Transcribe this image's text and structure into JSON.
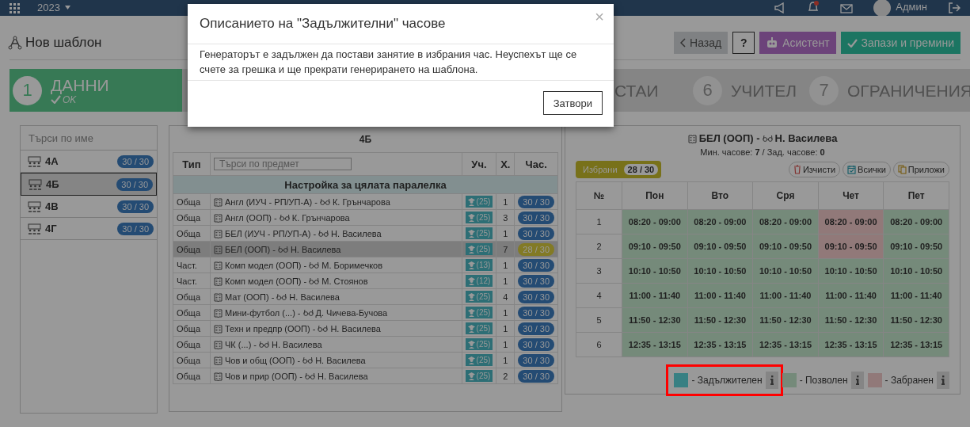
{
  "header": {
    "year": "2023",
    "user": "Админ"
  },
  "page": {
    "title": "Нов шаблон",
    "buttons": [
      {
        "label": "Назад",
        "kind": "back"
      },
      {
        "label": "?",
        "kind": "help"
      },
      {
        "label": "Асистент",
        "kind": "assistant"
      },
      {
        "label": "Запази и премини",
        "kind": "save"
      }
    ]
  },
  "steps": [
    {
      "number": "1",
      "label": "ДАННИ",
      "status": "OK",
      "done": true
    },
    {
      "label": "СТАИ",
      "done": false
    },
    {
      "number": "6",
      "label": "УЧИТЕЛ",
      "done": false
    },
    {
      "number": "7",
      "label": "ОГРАНИЧЕНИЯ",
      "done": false
    }
  ],
  "classes": {
    "search_placeholder": "Търси по име",
    "items": [
      {
        "name": "4А",
        "hours": "30 / 30",
        "selected": false
      },
      {
        "name": "4Б",
        "hours": "30 / 30",
        "selected": true
      },
      {
        "name": "4В",
        "hours": "30 / 30",
        "selected": false
      },
      {
        "name": "4Г",
        "hours": "30 / 30",
        "selected": false
      }
    ]
  },
  "subjects": {
    "class_name": "4Б",
    "columns": [
      "Тип",
      "Уч.",
      "Х.",
      "Час."
    ],
    "search_placeholder": "Търси по предмет",
    "group": "Настройка за цялата паралелка",
    "rows": [
      {
        "type": "Обща",
        "subject": "Англ (ИУЧ - РП/УП-А) -",
        "teacher": "К. Грънчарова",
        "students": "(25)",
        "count": "1",
        "hours": "30 / 30",
        "full": true,
        "selected": false
      },
      {
        "type": "Обща",
        "subject": "Англ (ООП) -",
        "teacher": "К. Грънчарова",
        "students": "(25)",
        "count": "3",
        "hours": "30 / 30",
        "full": true,
        "selected": false
      },
      {
        "type": "Обща",
        "subject": "БЕЛ (ИУЧ - РП/УП-А) -",
        "teacher": "Н. Василева",
        "students": "(25)",
        "count": "1",
        "hours": "30 / 30",
        "full": true,
        "selected": false
      },
      {
        "type": "Обща",
        "subject": "БЕЛ (ООП) -",
        "teacher": "Н. Василева",
        "students": "(25)",
        "count": "7",
        "hours": "28 / 30",
        "full": false,
        "selected": true
      },
      {
        "type": "Част.",
        "subject": "Комп модел (ООП) -",
        "teacher": "М. Боримечков",
        "students": "(13)",
        "count": "1",
        "hours": "30 / 30",
        "full": true,
        "selected": false
      },
      {
        "type": "Част.",
        "subject": "Комп модел (ООП) -",
        "teacher": "М. Стоянов",
        "students": "(12)",
        "count": "1",
        "hours": "30 / 30",
        "full": true,
        "selected": false
      },
      {
        "type": "Обща",
        "subject": "Мат (ООП) -",
        "teacher": "Н. Василева",
        "students": "(25)",
        "count": "4",
        "hours": "30 / 30",
        "full": true,
        "selected": false
      },
      {
        "type": "Обща",
        "subject": "Мини-футбол (...) -",
        "teacher": "Д. Чичева-Бучова",
        "students": "(25)",
        "count": "1",
        "hours": "30 / 30",
        "full": true,
        "selected": false
      },
      {
        "type": "Обща",
        "subject": "Техн и предпр (ООП) -",
        "teacher": "Н. Василева",
        "students": "(25)",
        "count": "1",
        "hours": "30 / 30",
        "full": true,
        "selected": false
      },
      {
        "type": "Обща",
        "subject": "ЧК (...) -",
        "teacher": "Н. Василева",
        "students": "(25)",
        "count": "1",
        "hours": "30 / 30",
        "full": true,
        "selected": false
      },
      {
        "type": "Обща",
        "subject": "Чов и общ (ООП) -",
        "teacher": "Н. Василева",
        "students": "(25)",
        "count": "1",
        "hours": "30 / 30",
        "full": true,
        "selected": false
      },
      {
        "type": "Обща",
        "subject": "Чов и прир (ООП) -",
        "teacher": "Н. Василева",
        "students": "(25)",
        "count": "2",
        "hours": "30 / 30",
        "full": true,
        "selected": false
      }
    ]
  },
  "detail": {
    "subject": "БЕЛ (ООП) -",
    "teacher": "Н. Василева",
    "hours_info": "Мин. часове: **7** / Зад. часове: **0**",
    "selected_label": "Избрани",
    "selected_count": "28 / 30",
    "actions": [
      {
        "label": "Изчисти",
        "kind": "clear"
      },
      {
        "label": "Всички",
        "kind": "all"
      },
      {
        "label": "Приложи",
        "kind": "apply"
      }
    ],
    "columns": [
      "№",
      "Пон",
      "Вто",
      "Сря",
      "Чет",
      "Пет"
    ],
    "rows": [
      {
        "number": "1",
        "slots": [
          {
            "time": "08:20 - 09:00",
            "forbidden": false
          },
          {
            "time": "08:20 - 09:00",
            "forbidden": false
          },
          {
            "time": "08:20 - 09:00",
            "forbidden": false
          },
          {
            "time": "08:20 - 09:00",
            "forbidden": true
          },
          {
            "time": "08:20 - 09:00",
            "forbidden": false
          }
        ]
      },
      {
        "number": "2",
        "slots": [
          {
            "time": "09:10 - 09:50",
            "forbidden": false
          },
          {
            "time": "09:10 - 09:50",
            "forbidden": false
          },
          {
            "time": "09:10 - 09:50",
            "forbidden": false
          },
          {
            "time": "09:10 - 09:50",
            "forbidden": true
          },
          {
            "time": "09:10 - 09:50",
            "forbidden": false
          }
        ]
      },
      {
        "number": "3",
        "slots": [
          {
            "time": "10:10 - 10:50",
            "forbidden": false
          },
          {
            "time": "10:10 - 10:50",
            "forbidden": false
          },
          {
            "time": "10:10 - 10:50",
            "forbidden": false
          },
          {
            "time": "10:10 - 10:50",
            "forbidden": false
          },
          {
            "time": "10:10 - 10:50",
            "forbidden": false
          }
        ]
      },
      {
        "number": "4",
        "slots": [
          {
            "time": "11:00 - 11:40",
            "forbidden": false
          },
          {
            "time": "11:00 - 11:40",
            "forbidden": false
          },
          {
            "time": "11:00 - 11:40",
            "forbidden": false
          },
          {
            "time": "11:00 - 11:40",
            "forbidden": false
          },
          {
            "time": "11:00 - 11:40",
            "forbidden": false
          }
        ]
      },
      {
        "number": "5",
        "slots": [
          {
            "time": "11:50 - 12:30",
            "forbidden": false
          },
          {
            "time": "11:50 - 12:30",
            "forbidden": false
          },
          {
            "time": "11:50 - 12:30",
            "forbidden": false
          },
          {
            "time": "11:50 - 12:30",
            "forbidden": false
          },
          {
            "time": "11:50 - 12:30",
            "forbidden": false
          }
        ]
      },
      {
        "number": "6",
        "slots": [
          {
            "time": "12:35 - 13:15",
            "forbidden": false
          },
          {
            "time": "12:35 - 13:15",
            "forbidden": false
          },
          {
            "time": "12:35 - 13:15",
            "forbidden": false
          },
          {
            "time": "12:35 - 13:15",
            "forbidden": false
          },
          {
            "time": "12:35 - 13:15",
            "forbidden": false
          }
        ]
      }
    ],
    "legend": [
      {
        "label": "- Задължителен",
        "kind": "required",
        "highlighted": true
      },
      {
        "label": "- Позволен",
        "kind": "allowed",
        "highlighted": false
      },
      {
        "label": "- Забранен",
        "kind": "forbidden",
        "highlighted": false
      }
    ]
  },
  "modal": {
    "title": "Описанието на \"Задължителни\" часове",
    "close_icon": "×",
    "body": "Генераторът е задължен да постави занятие в избрания час. Неуспехът ще се счете за грешка и ще прекрати генерирането на шаблона.",
    "close_button": "Затвори"
  }
}
